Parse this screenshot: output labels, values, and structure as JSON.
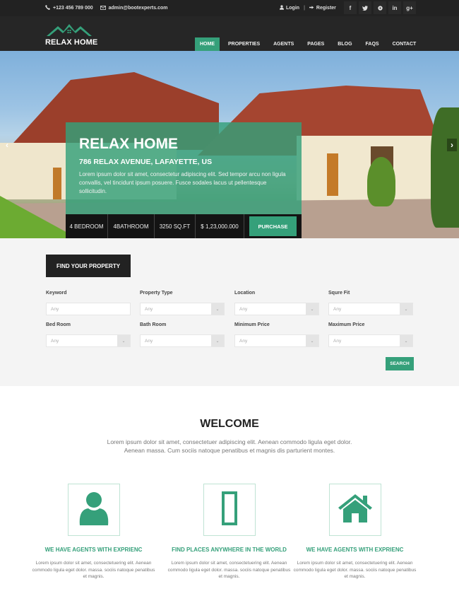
{
  "topbar": {
    "phone": "+123 456 789 000",
    "email": "admin@bootexperts.com",
    "login": "Login",
    "separator": "|",
    "register": "Register",
    "social": [
      {
        "icon": "facebook-icon",
        "glyph": "f"
      },
      {
        "icon": "twitter-icon",
        "glyph": "t"
      },
      {
        "icon": "pinterest-icon",
        "glyph": "p"
      },
      {
        "icon": "linkedin-icon",
        "glyph": "in"
      },
      {
        "icon": "google-plus-icon",
        "glyph": "g+"
      }
    ]
  },
  "header": {
    "logo_text": "RELAX HOME",
    "nav": [
      "HOME",
      "PROPERTIES",
      "AGENTS",
      "PAGES",
      "BLOG",
      "FAQS",
      "CONTACT"
    ],
    "active_nav": "HOME"
  },
  "hero": {
    "title": "RELAX HOME",
    "address": "786 RELAX AVENUE, LAFAYETTE, US",
    "description": "Lorem ipsum dolor sit amet, consectetur adipiscing elit. Sed tempor arcu non ligula convallis, vel tincidunt ipsum posuere. Fusce sodales lacus ut pellentesque sollicitudin.",
    "prev_glyph": "‹",
    "next_glyph": "›",
    "info": {
      "bedrooms": "4 BEDROOM",
      "bathrooms": "4BATHROOM",
      "area": "3250 SQ.FT",
      "price": "$ 1,23,000.000",
      "purchase_label": "PURCHASE"
    }
  },
  "search": {
    "heading_button": "FIND YOUR PROPERTY",
    "fields": [
      {
        "label": "Keyword",
        "value": "Any",
        "type": "text"
      },
      {
        "label": "Property Type",
        "value": "Any",
        "type": "select"
      },
      {
        "label": "Location",
        "value": "Any",
        "type": "select"
      },
      {
        "label": "Squre Fit",
        "value": "Any",
        "type": "select"
      },
      {
        "label": "Bed Room",
        "value": "Any",
        "type": "select"
      },
      {
        "label": "Bath Room",
        "value": "Any",
        "type": "select"
      },
      {
        "label": "Minimum Price",
        "value": "Any",
        "type": "select"
      },
      {
        "label": "Maximum Price",
        "value": "Any",
        "type": "select"
      }
    ],
    "caret_glyph": "⌄",
    "submit_label": "SEARCH"
  },
  "welcome": {
    "title": "WELCOME",
    "text": "Lorem ipsum dolor sit amet, consectetuer adipiscing elit. Aenean commodo ligula eget dolor. Aenean massa. Cum sociis natoque penatibus et magnis dis parturient montes."
  },
  "features": [
    {
      "icon": "user-icon",
      "title": "WE HAVE AGENTS WITH EXPRIENC",
      "text": "Lorem ipsum dolor sit amet, consectetuering elit. Aenean commodo ligula eget dolor. massa. sociis natoque penatibus et magnis."
    },
    {
      "icon": "map-placeholder-icon",
      "title": "FIND PLACES ANYWHERE IN THE WORLD",
      "text": "Lorem ipsum dolor sit amet, consectetuering elit. Aenean commodo ligula eget dolor. massa. sociis natoque penatibus et magnis."
    },
    {
      "icon": "home-icon",
      "title": "WE HAVE AGENTS WITH EXPRIENC",
      "text": "Lorem ipsum dolor sit amet, consectetuering elit. Aenean commodo ligula eget dolor. massa. sociis natoque penatibus et magnis."
    }
  ],
  "colors": {
    "accent": "#35a07a",
    "dark": "#222222",
    "header": "#262626",
    "search_bg": "#f4f4f4"
  }
}
